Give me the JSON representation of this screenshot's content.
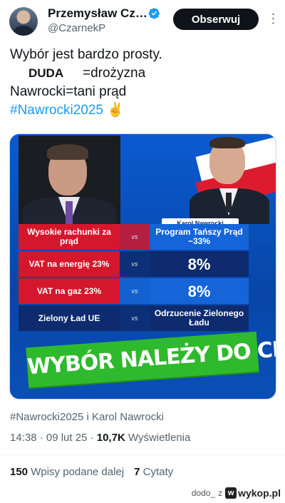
{
  "author": {
    "name": "Przemysław Cz…",
    "handle": "@CzarnekP",
    "follow_label": "Obserwuj",
    "verified_color": "#1d9bf0"
  },
  "tweet": {
    "line1": "Wybór jest bardzo prosty.",
    "duda": "DUDA",
    "line2_rest": "=drożyzna",
    "line3": "Nawrocki=tani prąd",
    "hashtag": "#Nawrocki2025",
    "emoji": "✌️"
  },
  "image": {
    "name_tag": "Karol Nawrocki",
    "rows": [
      {
        "left": "Wysokie rachunki za prąd",
        "mid": "vs",
        "right": "Program Tańszy Prąd −33%"
      },
      {
        "left": "VAT na energię 23%",
        "mid": "vs",
        "right": "8%"
      },
      {
        "left": "VAT na gaz 23%",
        "mid": "vs",
        "right": "8%"
      },
      {
        "left": "Zielony Ład UE",
        "mid": "vs",
        "right": "Odrzucenie Zielonego Ładu"
      }
    ],
    "banner": "WYBÓR NALEŻY DO CIEBIE!"
  },
  "meta": {
    "hashtags": "#Nawrocki2025 i Karol Nawrocki",
    "time": "14:38 · 09 lut 25 · ",
    "views_count": "10,7K",
    "views_label": " Wyświetlenia"
  },
  "stats": {
    "reposts_count": "150",
    "reposts_label": " Wpisy podane dalej",
    "quotes_count": "7",
    "quotes_label": " Cytaty"
  },
  "footer": {
    "user": "dodo_",
    "z": "z",
    "site": "wykop.pl"
  }
}
